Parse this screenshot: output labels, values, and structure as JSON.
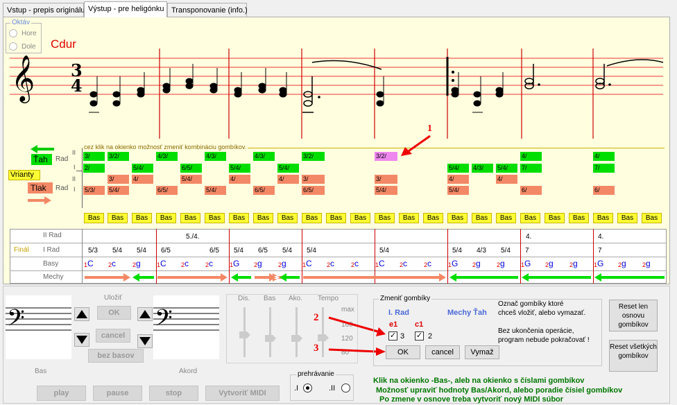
{
  "tabs": [
    "Vstup - prepis originálu",
    "Výstup - pre heligónku",
    "Transponovanie (info.)"
  ],
  "oktav": {
    "title": "Oktáv",
    "options": [
      "Hore",
      "Dole"
    ]
  },
  "key_name": "Cdur",
  "time_sig": {
    "top": "3",
    "bottom": "4"
  },
  "hint_text": "cez klik na okienko možnosť zmeniť kombináciu gombíkov.",
  "left_labels": {
    "tah": "Ťah",
    "tlak": "Tlak",
    "rad": "Rad",
    "rad_ii": "II",
    "rad_i": "I",
    "varianty": "Vrianty"
  },
  "annotation_1": "1",
  "rows": {
    "tah_ii": [
      "3/",
      "3/2/",
      "4/3/",
      "4/3/",
      "4/3/",
      "3/2/",
      "3/2/",
      "4/",
      "4/"
    ],
    "tah_i": [
      "2/",
      "5/4/",
      "6/5/",
      "5/4/",
      "5/4/",
      "5/4/",
      "4/3/",
      "5/4/",
      "7/",
      "7/"
    ],
    "tlak_ii": [
      "3/",
      "4/",
      "5/4/",
      "4/",
      "4/",
      "3/",
      "3/",
      "4/",
      "4/"
    ],
    "tlak_i": [
      "5/3/",
      "5/4/",
      "6/5/",
      "5/4/",
      "6/5/",
      "6/5/",
      "5/4/",
      "5/4/",
      "6/",
      "6/"
    ]
  },
  "bas_label": "Bas",
  "table": {
    "row_labels": [
      "II Rad",
      "I Rad",
      "Basy",
      "Mechy"
    ],
    "final_label": "Finál",
    "ii_rad": [
      "5./4.",
      "4.",
      "4."
    ],
    "i_rad": [
      "5/3",
      "5/4",
      "5/4",
      "6/5",
      "6/5",
      "5/4",
      "6/5",
      "5/4",
      "5/4",
      "5/4",
      "5/4",
      "4/3",
      "5/4",
      "7",
      "7"
    ],
    "basy": [
      [
        "1",
        "C"
      ],
      [
        "2",
        "c"
      ],
      [
        "2",
        "g"
      ],
      [
        "1",
        "C"
      ],
      [
        "2",
        "c"
      ],
      [
        "2",
        "c"
      ],
      [
        "1",
        "G"
      ],
      [
        "2",
        "g"
      ],
      [
        "2",
        "g"
      ],
      [
        "1",
        "C"
      ],
      [
        "2",
        "c"
      ],
      [
        "2",
        "c"
      ],
      [
        "1",
        "C"
      ],
      [
        "2",
        "c"
      ],
      [
        "2",
        "c"
      ],
      [
        "1",
        "G"
      ],
      [
        "2",
        "g"
      ],
      [
        "2",
        "g"
      ],
      [
        "1",
        "G"
      ],
      [
        "2",
        "g"
      ],
      [
        "2",
        "g"
      ],
      [
        "1",
        "G"
      ],
      [
        "2",
        "g"
      ],
      [
        "2",
        "g"
      ]
    ]
  },
  "bottom": {
    "ulozit": "Uložiť",
    "ok": "OK",
    "cancel": "cancel",
    "bez_basov": "bez basov",
    "bas_caption": "Bas",
    "akord_caption": "Akord",
    "sliders": [
      "Dis.",
      "Bas",
      "Ako.",
      "Tempo"
    ],
    "tempo_values": [
      "max",
      "160",
      "120",
      "80"
    ],
    "play": "play",
    "pause": "pause",
    "stop": "stop",
    "midi": "Vytvoriť MIDI",
    "prehravanie": "prehrávanie",
    "prehr_opts": [
      ".I",
      ".II"
    ]
  },
  "zmenit": {
    "title": "Zmeniť gombíky",
    "rad": "I.  Rad",
    "mechy": "Mechy Ťah",
    "note1": "e1",
    "note2": "c1",
    "chk1": "3",
    "chk2": "2",
    "ok": "OK",
    "cancel": "cancel",
    "vymaz": "Vymaž",
    "instructions": [
      "Označ gombíky ktoré",
      "chceš vložiť, alebo vymazať.",
      "Bez ukončenia operácie,",
      "program nebude pokračovať !"
    ]
  },
  "annotations": [
    "2",
    "3"
  ],
  "reset_basic": "Reset len osnovu gombíkov",
  "reset_all": "Reset všetkých gombíkov",
  "help_lines": [
    "Klik na okienko -Bas-, aleb na okienko s číslami gombíkov",
    "Možnosť upraviť hodnoty Bas/Akord, alebo poradie čísiel gombíkov",
    "Po zmene v osnove treba vytvoriť nový MIDI súbor"
  ]
}
